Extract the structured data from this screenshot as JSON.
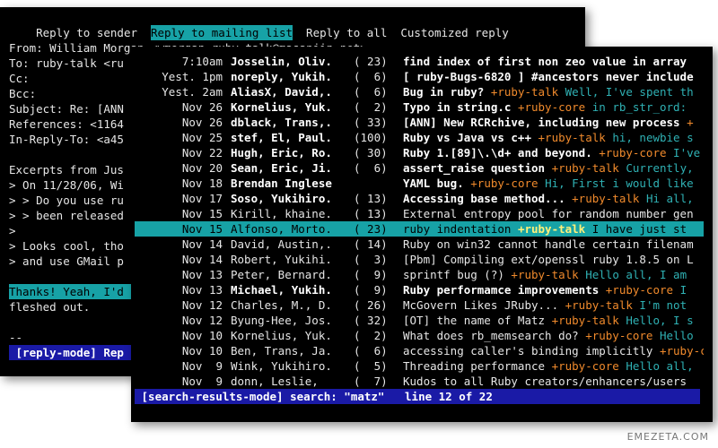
{
  "reply": {
    "menu": [
      "Reply to sender",
      "Reply to mailing list",
      "Reply to all",
      "Customized reply"
    ],
    "active_menu_index": 1,
    "header_lines": [
      "From: William Morgan <wmorgan-ruby-talk@masanjin.net>",
      "To: ruby-talk <ru",
      "Cc:",
      "Bcc:",
      "Subject: Re: [ANN",
      "References: <1164",
      "In-Reply-To: <a45"
    ],
    "body_lines": [
      "Excerpts from Jus",
      "> On 11/28/06, Wi",
      "> > Do you use ru",
      "> > been released",
      ">",
      "> Looks cool, tho",
      "> and use GMail p"
    ],
    "thanks_line": "Thanks! Yeah, I'd",
    "thanks_line_2": "fleshed out.",
    "sig": "--",
    "status": " [reply-mode] Rep"
  },
  "search": {
    "rows": [
      {
        "date": "7:10am",
        "from": "Josselin, Oliv.",
        "count": "( 23)",
        "subject": "find index of first non zeo value in array",
        "tag": "",
        "preview": "",
        "bold": true
      },
      {
        "date": "Yest. 1pm",
        "from": "noreply, Yukih.",
        "count": "(  6)",
        "subject": "[ ruby-Bugs-6820 ] #ancestors never include",
        "tag": "",
        "preview": "",
        "bold": true
      },
      {
        "date": "Yest. 2am",
        "from": "AliasX, David,.",
        "count": "(  6)",
        "subject": "Bug in ruby?",
        "tag": "+ruby-talk",
        "preview": "Well, I've spent th",
        "bold": true
      },
      {
        "date": "Nov 26",
        "from": "Kornelius, Yuk.",
        "count": "(  2)",
        "subject": "Typo in string.c",
        "tag": "+ruby-core",
        "preview": "in rb_str_ord:",
        "bold": true
      },
      {
        "date": "Nov 26",
        "from": "dblack, Trans,.",
        "count": "( 33)",
        "subject": "[ANN] New RCRchive, including new process",
        "tag": "+",
        "preview": "",
        "bold": true
      },
      {
        "date": "Nov 25",
        "from": "stef, El, Paul.",
        "count": "(100)",
        "subject": "Ruby vs Java vs c++",
        "tag": "+ruby-talk",
        "preview": "hi, newbie s",
        "bold": true
      },
      {
        "date": "Nov 22",
        "from": "Hugh, Eric, Ro.",
        "count": "( 30)",
        "subject": "Ruby 1.[89]\\.\\d+ and beyond.",
        "tag": "+ruby-core",
        "preview": "I've",
        "bold": true
      },
      {
        "date": "Nov 20",
        "from": "Sean, Eric, Ji.",
        "count": "(  6)",
        "subject": "assert_raise question",
        "tag": "+ruby-talk",
        "preview": "Currently,",
        "bold": true
      },
      {
        "date": "Nov 18",
        "from": "Brendan Inglese",
        "count": "",
        "subject": "YAML bug.",
        "tag": "+ruby-core",
        "preview": "Hi, First i would like",
        "bold": true
      },
      {
        "date": "Nov 17",
        "from": "Soso, Yukihiro.",
        "count": "( 13)",
        "subject": "Accessing base method...",
        "tag": "+ruby-talk",
        "preview": "Hi all,",
        "bold": true
      },
      {
        "date": "Nov 15",
        "from": "Kirill, khaine.",
        "count": "( 13)",
        "subject": "External entropy pool for random number gen",
        "tag": "",
        "preview": "",
        "bold": false
      },
      {
        "date": "Nov 15",
        "from": "Alfonso, Morto.",
        "count": "( 23)",
        "subject": "ruby indentation",
        "tag": "+ruby-talk",
        "preview": "I have just st",
        "bold": false,
        "selected": true
      },
      {
        "date": "Nov 14",
        "from": "David, Austin,.",
        "count": "( 14)",
        "subject": "Ruby on win32 cannot handle certain filenam",
        "tag": "",
        "preview": "",
        "bold": false
      },
      {
        "date": "Nov 14",
        "from": "Robert, Yukihi.",
        "count": "(  3)",
        "subject": "[Pbm] Compiling ext/openssl ruby 1.8.5 on L",
        "tag": "",
        "preview": "",
        "bold": false
      },
      {
        "date": "Nov 13",
        "from": "Peter, Bernard.",
        "count": "(  9)",
        "subject": "sprintf bug (?)",
        "tag": "+ruby-talk",
        "preview": "Hello all, I am",
        "bold": false
      },
      {
        "date": "Nov 13",
        "from": "Michael, Yukih.",
        "count": "(  9)",
        "subject": "Ruby performamce improvements",
        "tag": "+ruby-core",
        "preview": "I",
        "bold": true
      },
      {
        "date": "Nov 12",
        "from": "Charles, M., D.",
        "count": "( 26)",
        "subject": "McGovern Likes JRuby...",
        "tag": "+ruby-talk",
        "preview": "I'm not",
        "bold": false
      },
      {
        "date": "Nov 12",
        "from": "Byung-Hee, Jos.",
        "count": "( 32)",
        "subject": "[OT] the name of Matz",
        "tag": "+ruby-talk",
        "preview": "Hello, I s",
        "bold": false
      },
      {
        "date": "Nov 10",
        "from": "Kornelius, Yuk.",
        "count": "(  2)",
        "subject": "What does rb_memsearch do?",
        "tag": "+ruby-core",
        "preview": "Hello",
        "bold": false
      },
      {
        "date": "Nov 10",
        "from": "Ben, Trans, Ja.",
        "count": "(  6)",
        "subject": "accessing caller's binding implicitly",
        "tag": "+ruby-core",
        "preview": "",
        "bold": false
      },
      {
        "date": "Nov  9",
        "from": "Wink, Yukihiro.",
        "count": "(  5)",
        "subject": "Threading performance",
        "tag": "+ruby-core",
        "preview": "Hello all,",
        "bold": false
      },
      {
        "date": "Nov  9",
        "from": "donn, Leslie,",
        "count": "(  7)",
        "subject": "Kudos to all Ruby creators/enhancers/users",
        "tag": "",
        "preview": "",
        "bold": false
      }
    ],
    "status": " [search-results-mode] search: \"matz\"   line 12 of 22"
  },
  "watermark": "EMEZETA.COM",
  "colors": {
    "highlight": "#17a2a6",
    "status_bar": "#1a1aa6",
    "tag": "#f08a2c",
    "preview": "#2fb1b4"
  }
}
